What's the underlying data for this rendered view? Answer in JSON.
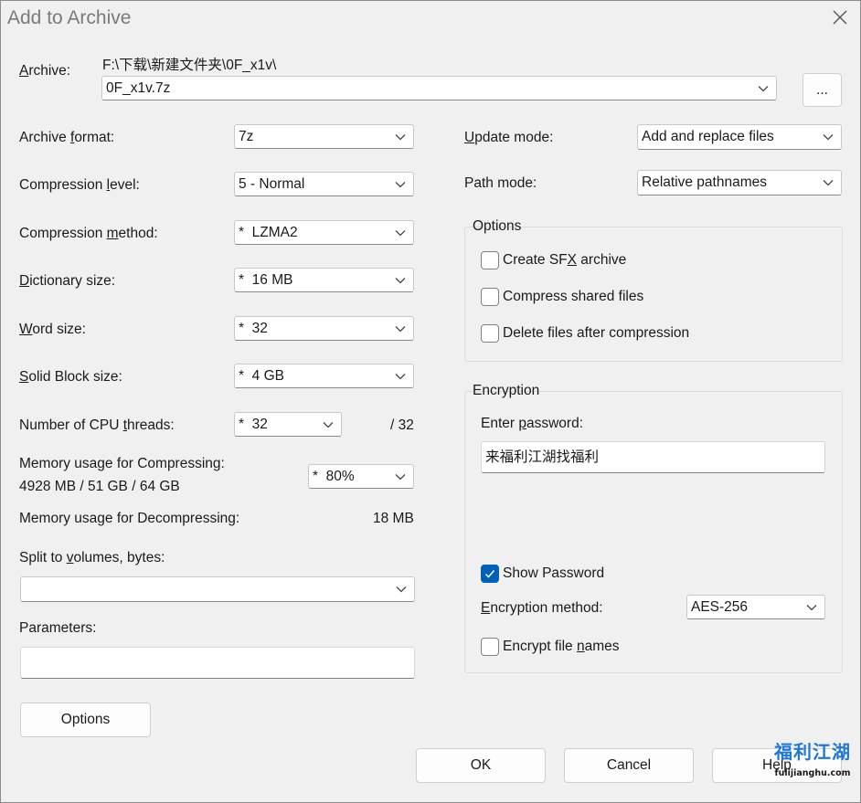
{
  "window": {
    "title": "Add to Archive"
  },
  "archive": {
    "label_u": "A",
    "label_rest": "rchive:",
    "path": "F:\\下载\\新建文件夹\\0F_x1v\\",
    "name": "0F_x1v.7z",
    "browse_label": "..."
  },
  "left": {
    "format": {
      "pre": "Archive ",
      "u": "f",
      "post": "ormat:",
      "value": "7z"
    },
    "level": {
      "pre": "Compression ",
      "u": "l",
      "post": "evel:",
      "value": "5 - Normal"
    },
    "method": {
      "pre": "Compression ",
      "u": "m",
      "post": "ethod:",
      "value": "*  LZMA2"
    },
    "dict": {
      "pre": "",
      "u": "D",
      "post": "ictionary size:",
      "value": "*  16 MB"
    },
    "word": {
      "pre": "",
      "u": "W",
      "post": "ord size:",
      "value": "*  32"
    },
    "solid": {
      "pre": "",
      "u": "S",
      "post": "olid Block size:",
      "value": "*  4 GB"
    },
    "threads": {
      "pre": "Number of CPU ",
      "u": "t",
      "post": "hreads:",
      "value": "*  32",
      "max": "/ 32"
    },
    "mem_comp": {
      "label": "Memory usage for Compressing:",
      "info": "4928 MB / 51 GB / 64 GB",
      "value": "*  80%"
    },
    "mem_decomp": {
      "label": "Memory usage for Decompressing:",
      "value": "18 MB"
    },
    "split": {
      "pre": "Split to ",
      "u": "v",
      "post": "olumes, bytes:",
      "value": ""
    },
    "params": {
      "label": "Parameters:",
      "value": ""
    },
    "options_button": "Options"
  },
  "right": {
    "update": {
      "u": "U",
      "post": "pdate mode:",
      "value": "Add and replace files"
    },
    "path": {
      "label": "Path mode:",
      "value": "Relative pathnames"
    },
    "options_group": {
      "title": "Options",
      "sfx": {
        "pre": "Create SF",
        "u": "X",
        "post": " archive",
        "checked": false
      },
      "shared": {
        "label": "Compress shared files",
        "checked": false
      },
      "delete": {
        "label": "Delete files after compression",
        "checked": false
      }
    },
    "encryption": {
      "title": "Encryption",
      "enter_pre": "Enter ",
      "enter_u": "p",
      "enter_post": "assword:",
      "password": "来福利江湖找福利",
      "show_password": {
        "label": "Show Password",
        "checked": true
      },
      "method": {
        "u": "E",
        "post": "ncryption method:",
        "value": "AES-256"
      },
      "encrypt_names": {
        "pre": "Encrypt file ",
        "u": "n",
        "post": "ames",
        "checked": false
      }
    }
  },
  "buttons": {
    "ok": "OK",
    "cancel": "Cancel",
    "help": "Help"
  },
  "watermark": {
    "text": "福利江湖",
    "url": "fulijianghu.com"
  }
}
